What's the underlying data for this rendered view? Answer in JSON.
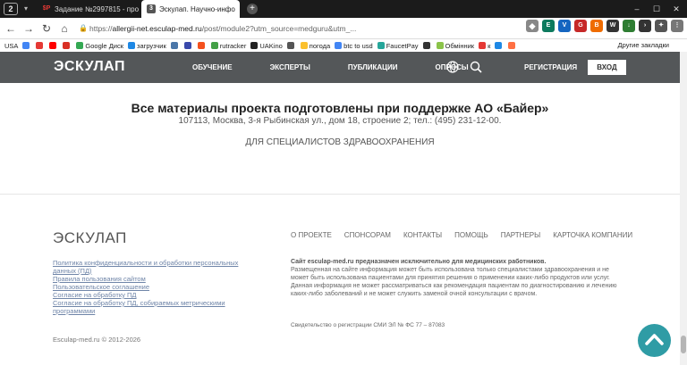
{
  "browser": {
    "tab_counter": "2",
    "tabs": [
      {
        "label": "Задание №2997815 - про",
        "favicon": "$P",
        "favicon_color": "#e53935"
      },
      {
        "label": "Эскулап. Научно-инфо",
        "favicon": "3",
        "favicon_color": "#555555"
      }
    ],
    "url_host": "allergii-net.esculap-med.ru",
    "url_path": "/post/module2?utm_source=medguru&utm_...",
    "url_scheme": "https://",
    "bookmarks": [
      "USA",
      "Google Диск",
      "загрузчик",
      "rutracker",
      "UAKino",
      "погода",
      "btc to usd",
      "FaucetPay",
      "Обмінник",
      "к"
    ],
    "bookmarks_other": "Другие закладки"
  },
  "site": {
    "logo": "ЭСКУЛАП",
    "nav": [
      "ОБУЧЕНИЕ",
      "ЭКСПЕРТЫ",
      "ПУБЛИКАЦИИ",
      "ОПРОСЫ"
    ],
    "register": "РЕГИСТРАЦИЯ",
    "login": "ВХОД",
    "sponsor_title": "Все материалы проекта подготовлены при поддержке АО «Байер»",
    "address": "107113, Москва, 3-я Рыбинская ул., дом 18, строение 2; тел.: (495) 231-12-00.",
    "audience": "ДЛЯ СПЕЦИАЛИСТОВ ЗДРАВООХРАНЕНИЯ",
    "footer": {
      "logo": "ЭСКУЛАП",
      "links": [
        "Политика конфиденциальности и обработки персональных данных (ПД)",
        "Правила пользования сайтом",
        "Пользовательское соглашение",
        "Согласие на обработку ПД",
        "Согласие на обработку ПД, собираемых метрическими программами"
      ],
      "copyright": "Esculap-med.ru © 2012-2026",
      "nav": [
        "О ПРОЕКТЕ",
        "СПОНСОРАМ",
        "КОНТАКТЫ",
        "ПОМОЩЬ",
        "ПАРТНЕРЫ",
        "КАРТОЧКА КОМПАНИИ"
      ],
      "disclaimer_title": "Сайт esculap-med.ru предназначен исключительно для медицинских работников.",
      "disclaimer": "Размещенная на сайте информация может быть использована только специалистами здравоохранения и не может быть использована пациентами для принятия решения о применении каких-либо продуктов или услуг. Данная информация не может рассматриваться как рекомендация пациентам по диагностированию и лечению каких-либо заболеваний и не может служить заменой очной консультации с врачом.",
      "registration": "Свидетельство о регистрации СМИ ЭЛ № ФС 77 – 87083"
    }
  },
  "colors": {
    "nav_bg": "#545759",
    "accent": "#2f9ca5",
    "link": "#6f85a8"
  }
}
